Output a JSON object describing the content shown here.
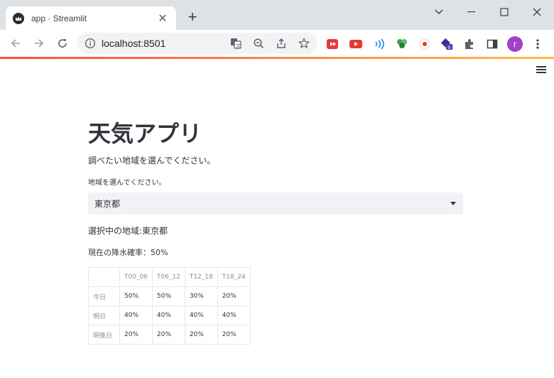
{
  "browser": {
    "tab_title": "app · Streamlit",
    "url": "localhost:8501",
    "extension_badge": "9",
    "avatar_letter": "r"
  },
  "app": {
    "title": "天気アプリ",
    "description": "調べたい地域を選んでください。",
    "select_label": "地域を選んでください。",
    "selected_value": "東京都",
    "selected_area_text": "選択中の地域:東京都",
    "rain_now_text": "現在の降水確率：50%"
  },
  "table": {
    "columns": [
      "",
      "T00_06",
      "T06_12",
      "T12_18",
      "T18_24"
    ],
    "rows": [
      {
        "label": "今日",
        "values": [
          "50%",
          "50%",
          "30%",
          "20%"
        ]
      },
      {
        "label": "明日",
        "values": [
          "40%",
          "40%",
          "40%",
          "40%"
        ]
      },
      {
        "label": "明後日",
        "values": [
          "20%",
          "20%",
          "20%",
          "20%"
        ]
      }
    ]
  },
  "colors": {
    "accent_red": "#ff4b4b",
    "accent_yellow": "#ffbd45",
    "text": "#31333f",
    "avatar": "#a142c9"
  },
  "icons": [
    "streamlit-logo-icon",
    "close-icon",
    "plus-icon",
    "back-icon",
    "forward-icon",
    "reload-icon",
    "info-icon",
    "translate-icon",
    "zoom-out-icon",
    "share-icon",
    "star-icon",
    "extension-icon",
    "puzzle-icon",
    "side-panel-icon",
    "more-vert-icon",
    "hamburger-menu-icon",
    "caret-down-icon"
  ]
}
